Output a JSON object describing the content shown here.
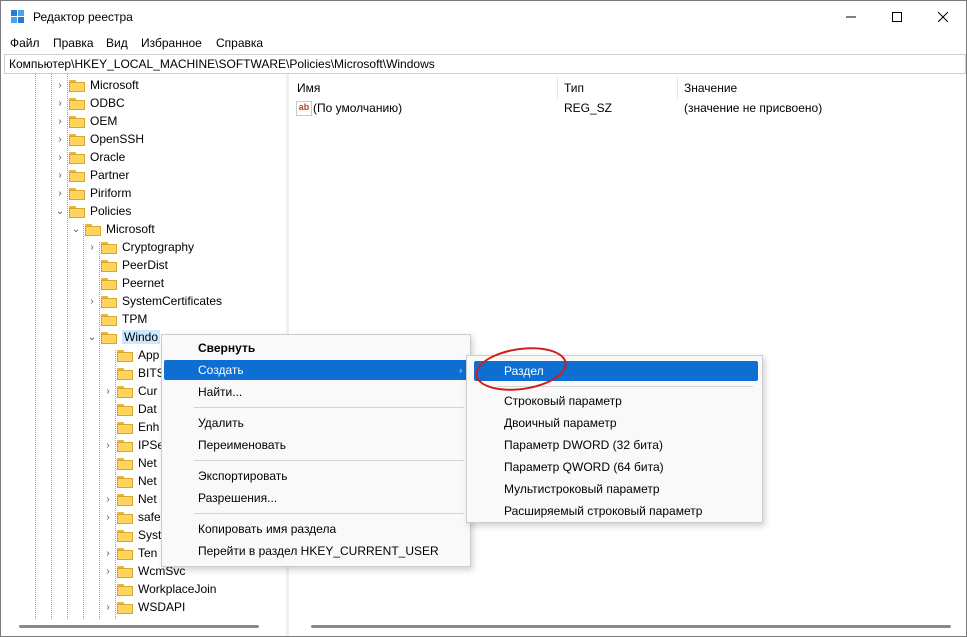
{
  "window": {
    "title": "Редактор реестра",
    "controls": {
      "minimize": "—",
      "maximize": "☐",
      "close": "✕"
    }
  },
  "menubar": [
    "Файл",
    "Правка",
    "Вид",
    "Избранное",
    "Справка"
  ],
  "address": "Компьютер\\HKEY_LOCAL_MACHINE\\SOFTWARE\\Policies\\Microsoft\\Windows",
  "tree": {
    "items": [
      {
        "label": "Microsoft",
        "expander": "›"
      },
      {
        "label": "ODBC",
        "expander": "›"
      },
      {
        "label": "OEM",
        "expander": "›"
      },
      {
        "label": "OpenSSH",
        "expander": "›"
      },
      {
        "label": "Oracle",
        "expander": "›"
      },
      {
        "label": "Partner",
        "expander": "›"
      },
      {
        "label": "Piriform",
        "expander": "›"
      },
      {
        "label": "Policies",
        "expander": "⌄"
      },
      {
        "label": "Microsoft",
        "expander": "⌄"
      },
      {
        "label": "Cryptography",
        "expander": "›"
      },
      {
        "label": "PeerDist",
        "expander": ""
      },
      {
        "label": "Peernet",
        "expander": ""
      },
      {
        "label": "SystemCertificates",
        "expander": "›"
      },
      {
        "label": "TPM",
        "expander": ""
      },
      {
        "label": "Windo",
        "expander": "⌄"
      },
      {
        "label": "App",
        "expander": ""
      },
      {
        "label": "BITS",
        "expander": ""
      },
      {
        "label": "Cur",
        "expander": "›"
      },
      {
        "label": "Dat",
        "expander": ""
      },
      {
        "label": "Enh",
        "expander": ""
      },
      {
        "label": "IPSe",
        "expander": "›"
      },
      {
        "label": "Net",
        "expander": ""
      },
      {
        "label": "Net",
        "expander": ""
      },
      {
        "label": "Net",
        "expander": "›"
      },
      {
        "label": "safe",
        "expander": "›"
      },
      {
        "label": "Syst",
        "expander": ""
      },
      {
        "label": "Ten",
        "expander": "›"
      },
      {
        "label": "WcmSvc",
        "expander": "›"
      },
      {
        "label": "WorkplaceJoin",
        "expander": ""
      },
      {
        "label": "WSDAPI",
        "expander": "›"
      }
    ]
  },
  "list": {
    "columns": {
      "name": "Имя",
      "type": "Тип",
      "value": "Значение"
    },
    "rows": [
      {
        "icon": "ab",
        "name": "(По умолчанию)",
        "type": "REG_SZ",
        "value": "(значение не присвоено)"
      }
    ]
  },
  "context_menu": {
    "items": [
      "Свернуть",
      "Создать",
      "Найти...",
      "Удалить",
      "Переименовать",
      "Экспортировать",
      "Разрешения...",
      "Копировать имя раздела",
      "Перейти в раздел HKEY_CURRENT_USER"
    ],
    "submenu_arrow": "›"
  },
  "submenu": {
    "items": [
      "Раздел",
      "Строковый параметр",
      "Двоичный параметр",
      "Параметр DWORD (32 бита)",
      "Параметр QWORD (64 бита)",
      "Мультистроковый параметр",
      "Расширяемый строковый параметр"
    ]
  },
  "colors": {
    "highlight": "#0c6fd1",
    "annotation": "#d21c1c",
    "folder": "#ffd35c"
  }
}
